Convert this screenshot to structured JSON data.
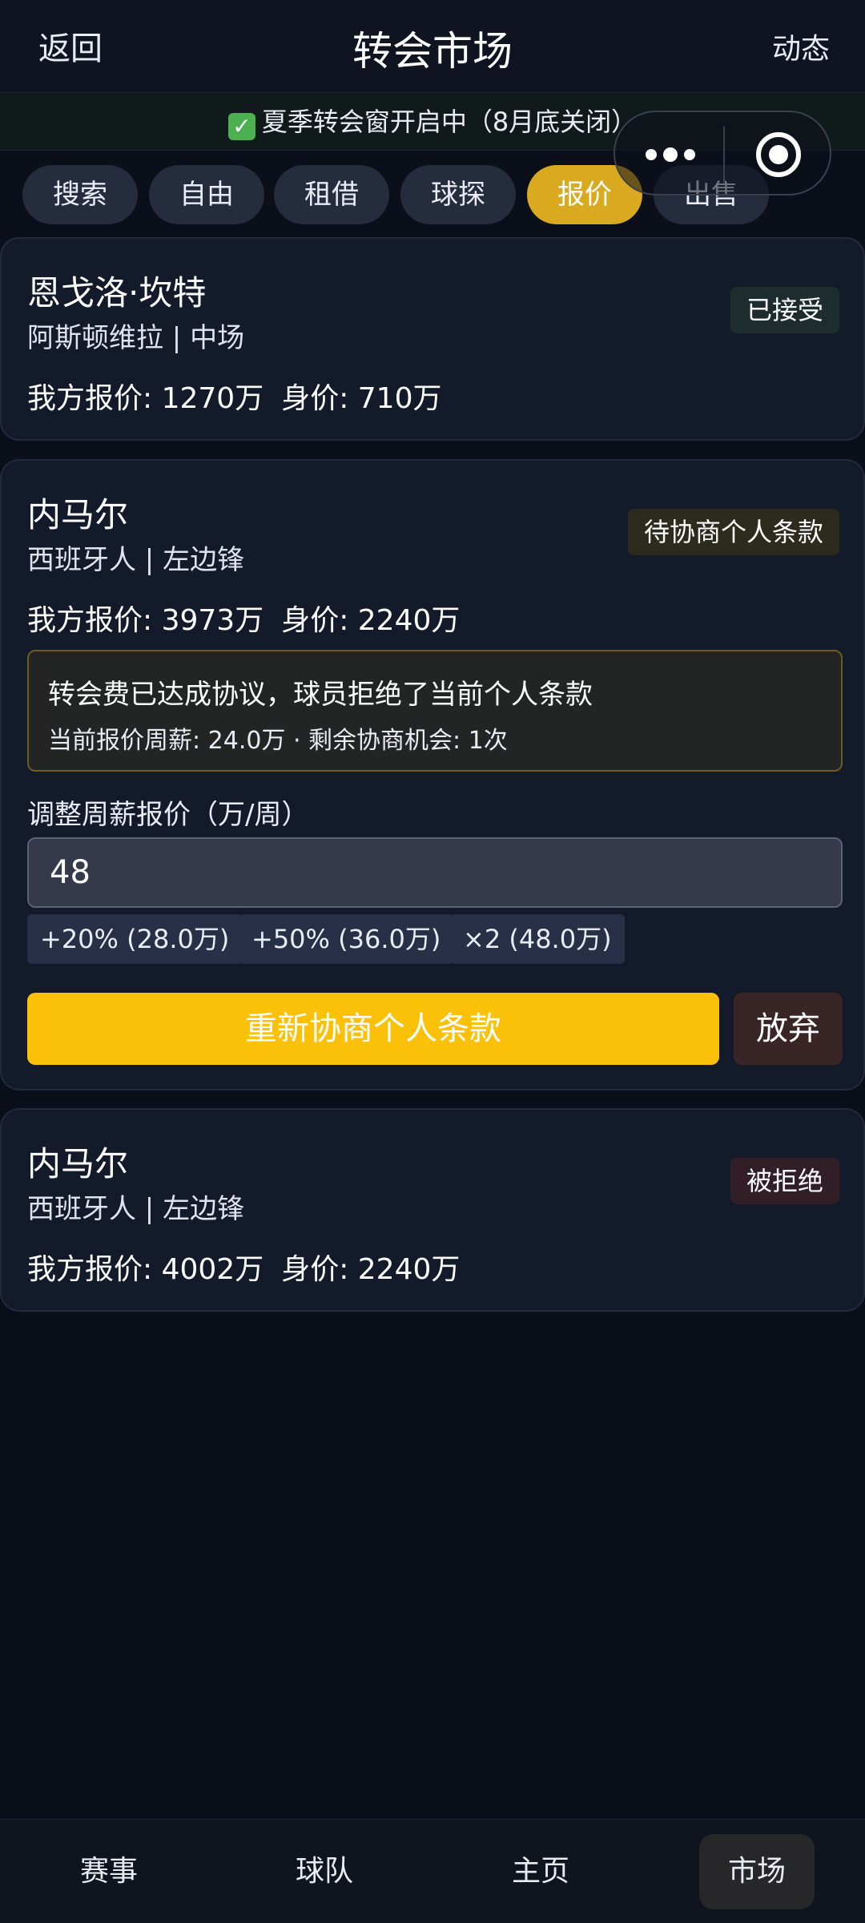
{
  "header": {
    "back_label": "返回",
    "title": "转会市场",
    "activity_label": "动态"
  },
  "notice": {
    "text": "夏季转会窗开启中（8月底关闭）"
  },
  "tabs": [
    {
      "label": "搜索",
      "active": false
    },
    {
      "label": "自由",
      "active": false
    },
    {
      "label": "租借",
      "active": false
    },
    {
      "label": "球探",
      "active": false
    },
    {
      "label": "报价",
      "active": true
    },
    {
      "label": "出售",
      "active": false
    }
  ],
  "offers": [
    {
      "name": "恩戈洛·坎特",
      "meta": "阿斯顿维拉 | 中场",
      "our_offer": "我方报价: 1270万",
      "value": "身价: 710万",
      "status": "已接受"
    },
    {
      "name": "内马尔",
      "meta": "西班牙人 | 左边锋",
      "our_offer": "我方报价: 3973万",
      "value": "身价: 2240万",
      "status": "待协商个人条款",
      "alert": {
        "line1": "转会费已达成协议，球员拒绝了当前个人条款",
        "line2": "当前报价周薪: 24.0万 · 剩余协商机会: 1次"
      },
      "adjust_label": "调整周薪报价（万/周）",
      "wage_input": "48",
      "chips": [
        "+20% (28.0万)",
        "+50% (36.0万)",
        "×2 (48.0万)"
      ],
      "renegotiate_label": "重新协商个人条款",
      "abandon_label": "放弃"
    },
    {
      "name": "内马尔",
      "meta": "西班牙人 | 左边锋",
      "our_offer": "我方报价: 4002万",
      "value": "身价: 2240万",
      "status": "被拒绝"
    }
  ],
  "bottom_nav": [
    {
      "label": "赛事",
      "active": false
    },
    {
      "label": "球队",
      "active": false
    },
    {
      "label": "主页",
      "active": false
    },
    {
      "label": "市场",
      "active": true
    }
  ]
}
